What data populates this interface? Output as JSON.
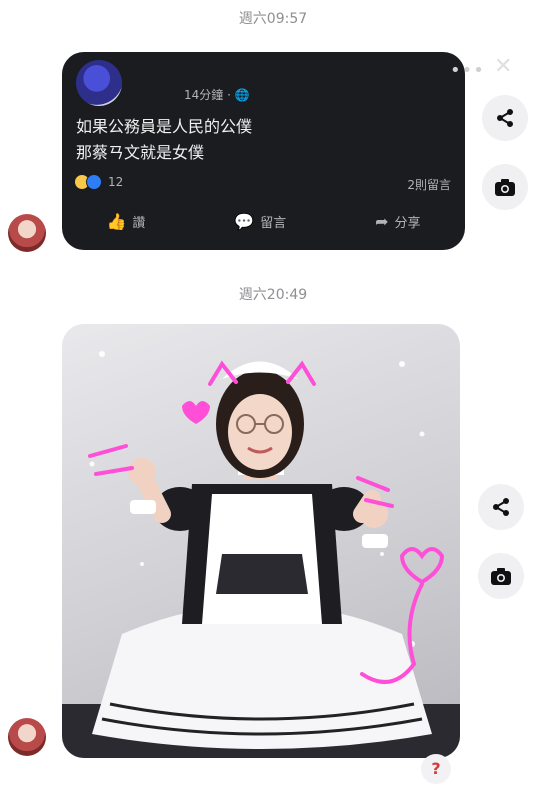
{
  "timestamps": {
    "first": "週六09:57",
    "second": "週六20:49"
  },
  "post": {
    "time_ago": "14分鐘 · ",
    "globe_icon": "globe-icon",
    "line1": "如果公務員是人民的公僕",
    "line2": "那蔡ㄢ文就是女僕",
    "reaction_count": "12",
    "comments": "2則留言",
    "actions": {
      "like": "讚",
      "comment": "留言",
      "share": "分享"
    }
  },
  "help_label": "?",
  "colors": {
    "card_bg": "#1b1c20",
    "accent_pink": "#ff4fd8"
  }
}
